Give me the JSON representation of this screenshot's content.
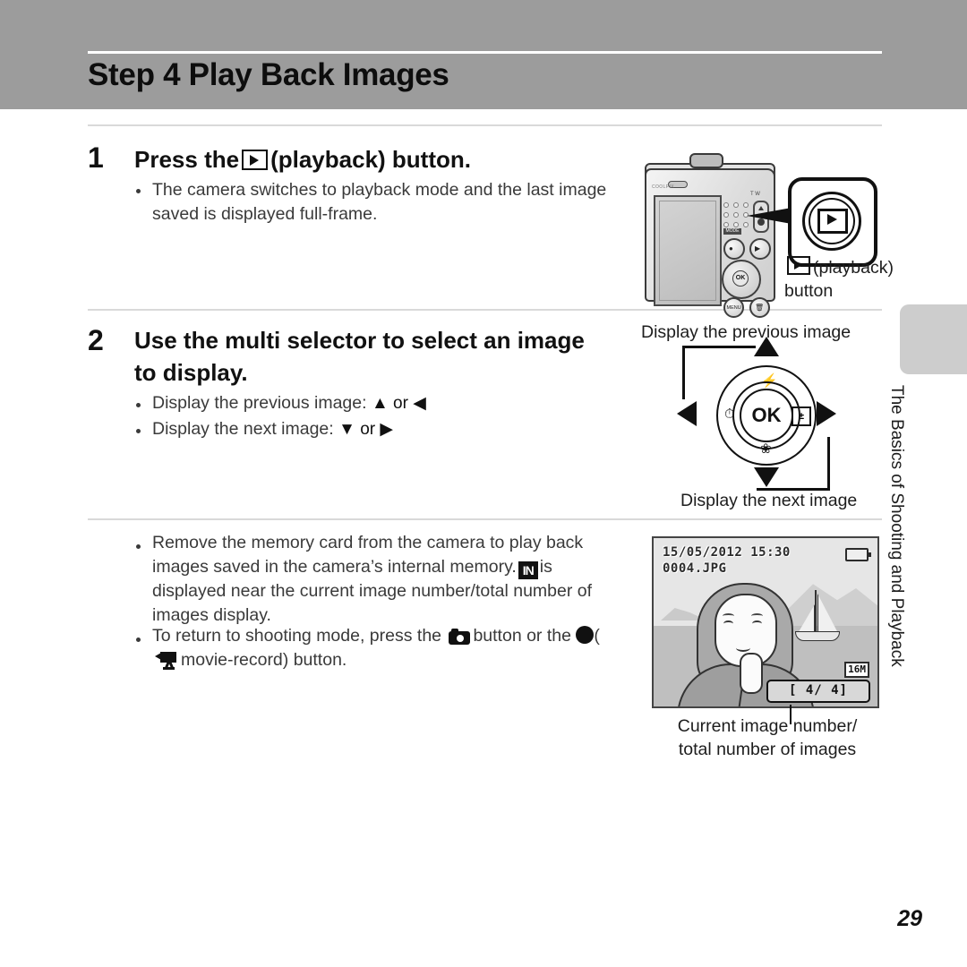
{
  "header": {
    "title": "Step 4 Play Back Images"
  },
  "steps": [
    {
      "number": "1",
      "heading_before": "Press the",
      "heading_icon": "playback-icon",
      "heading_after": "(playback) button.",
      "bullets": [
        "The camera switches to playback mode and the last image saved is displayed full-frame."
      ]
    },
    {
      "number": "2",
      "heading": "Use the multi selector to select an image to display.",
      "bullets": [
        {
          "label": "Display the previous image:",
          "icons": "▲ or ◀"
        },
        {
          "label": "Display the next image:",
          "icons": "▼ or ▶"
        }
      ]
    }
  ],
  "notes": {
    "note1_part1": "Remove the memory card from the camera to play back images saved in the camera’s internal memory.",
    "note1_icon": "IN",
    "note1_part2": "is displayed near the current image number/total number of images display.",
    "note2_part1": "To return to shooting mode, press the",
    "note2_icon_camera": "camera-icon",
    "note2_part2": "button or the",
    "note2_icon_record": "record-dot-icon",
    "note2_part3": "(",
    "note2_icon_movie": "movie-camera-icon",
    "note2_part4": "movie-record) button."
  },
  "camera_illustration": {
    "callout_caption_line1": "(playback)",
    "callout_caption_line2": "button",
    "callout_icon": "playback-icon",
    "lcd_label": "camera-lcd",
    "ok_label": "OK",
    "menu_label": "MENU",
    "mode_label": "MODE"
  },
  "multi_selector": {
    "caption_top": "Display the previous image",
    "caption_bottom": "Display the next image",
    "center_label": "OK",
    "icon_up": "flash-icon",
    "icon_left": "self-timer-icon",
    "icon_right": "exposure-compensation-icon",
    "icon_down": "macro-icon",
    "glyph_up": "⚡",
    "glyph_left": "⏱",
    "glyph_right": "±",
    "glyph_down": "❀"
  },
  "lcd_screen": {
    "date": "15/05/2012  15:30",
    "filename": "0004.JPG",
    "image_size_badge": "16M",
    "counter": "[   4/   4]",
    "battery_icon": "battery-icon",
    "caption_line1": "Current image number/",
    "caption_line2": "total number of images"
  },
  "side_tab": {
    "text": "The Basics of Shooting and Playback"
  },
  "footer": {
    "page_number": "29"
  },
  "colors": {
    "header_band": "#9c9c9c",
    "side_tab": "#cdcdcd",
    "rule": "#d9d9d9",
    "text": "#3a3a3a"
  }
}
